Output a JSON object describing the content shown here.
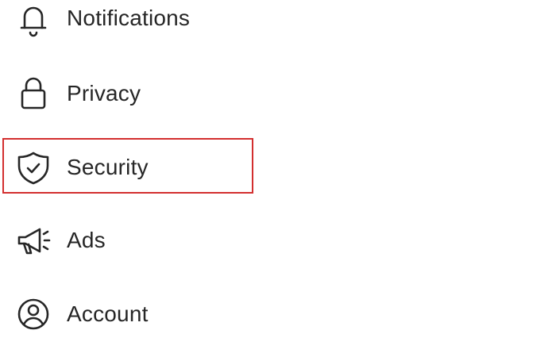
{
  "menu": {
    "items": [
      {
        "key": "notifications",
        "label": "Notifications",
        "icon": "bell-icon"
      },
      {
        "key": "privacy",
        "label": "Privacy",
        "icon": "lock-icon"
      },
      {
        "key": "security",
        "label": "Security",
        "icon": "shield-check-icon"
      },
      {
        "key": "ads",
        "label": "Ads",
        "icon": "megaphone-icon"
      },
      {
        "key": "account",
        "label": "Account",
        "icon": "user-circle-icon"
      }
    ],
    "highlighted": "security"
  },
  "colors": {
    "text": "#262626",
    "icon_stroke": "#262626",
    "highlight": "#d32f2f",
    "background": "#ffffff"
  }
}
